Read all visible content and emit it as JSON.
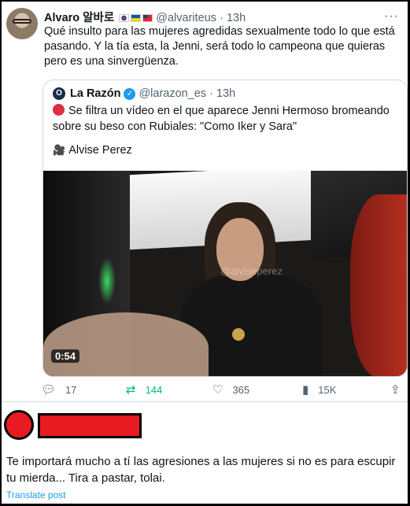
{
  "tweet": {
    "author_name": "Alvaro 알바로",
    "flags": [
      "kr-flag",
      "ua-flag",
      "tw-flag"
    ],
    "handle": "@alvariteus",
    "separator": "·",
    "time": "13h",
    "text": "Qué insulto para las mujeres agredidas sexualmente todo lo que está pasando. Y la tía esta, la Jenni, será todo lo campeona que quieras pero es una sinvergüenza.",
    "more_icon": "more-horizontal-icon"
  },
  "quote": {
    "logo_letter": "O",
    "name": "La Razón",
    "handle": "@larazon_es",
    "separator": "·",
    "time": "13h",
    "text": "Se filtra un vídeo en el que aparece Jenni Hermoso bromeando sobre su beso con Rubiales: \"Como Iker y Sara\"",
    "credit": "Alvise Perez",
    "video": {
      "watermark": "@alviseperez",
      "duration": "0:54"
    }
  },
  "actions": {
    "replies": "17",
    "retweets": "144",
    "likes": "365",
    "views": "15K"
  },
  "comment": {
    "text": "Te importará mucho a tí las agresiones a las mujeres si no es para escupir tu mierda... Tira a pastar, tolai.",
    "translate": "Translate post"
  },
  "colors": {
    "accent": "#1d9bf0",
    "retweet": "#00ba7c",
    "redaction": "#e81b22",
    "muted": "#536471"
  }
}
